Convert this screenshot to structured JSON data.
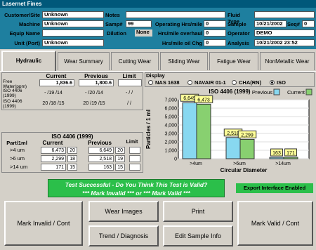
{
  "window": {
    "title": "Lasernet Fines"
  },
  "header": {
    "customer_label": "Customer/Site",
    "customer_value": "Unknown",
    "machine_label": "Machine",
    "machine_value": "Unknown",
    "equip_label": "Equip Name",
    "equip_value": "",
    "unit_label": "Unit (Port)",
    "unit_value": "Unknown",
    "notes_label": "Notes",
    "notes_value": "",
    "samp_label": "Samp#",
    "samp_value": "99",
    "dilution_label": "Dilution",
    "dilution_value": "None",
    "op_hrs_label": "Operating Hrs/mile",
    "op_hrs_value": "0",
    "overhaul_label": "Hrs/mile overhaul",
    "overhaul_value": "0",
    "oilchg_label": "Hrs/mile oil Chg",
    "oilchg_value": "0",
    "fluid_label": "Fluid Type",
    "fluid_value": "",
    "sample_label": "Sample",
    "sample_value": "10/21/2002",
    "seq_label": "Seq#",
    "seq_value": "0",
    "operator_label": "Operator",
    "operator_value": "DEMO",
    "analysis_label": "Analysis",
    "analysis_value": "10/21/2002 23:52"
  },
  "tabs": [
    "Hydraulic",
    "Wear Summary",
    "Cutting Wear",
    "Sliding Wear",
    "Fatigue Wear",
    "NonMetallic Wear"
  ],
  "summary": {
    "col_current": "Current",
    "col_previous": "Previous",
    "col_limit": "Limit",
    "free_water_label": "Free Water(ppm)",
    "free_water_current": "1,836.6",
    "free_water_previous": "1,800.6",
    "iso1999_label": "ISO 4406 (1999)",
    "iso1999_current": "- /19 /14",
    "iso1999_previous": "- /20 /14",
    "iso1999_limit": "- / /",
    "iso4406_label": "ISO 4406 (1999)",
    "iso4406_current": "20 /18 /15",
    "iso4406_previous": "20 /19 /15",
    "iso4406_limit": "/ /"
  },
  "counts": {
    "title": "ISO 4406 (1999)",
    "col_part": "Part/1ml",
    "col_current": "Current",
    "col_previous": "Previous",
    "col_limit": "Limit",
    "rows": [
      {
        "size": ">4 um",
        "current": "6,473",
        "cur_code": "20",
        "previous": "6,649",
        "prev_code": "20"
      },
      {
        "size": ">6 um",
        "current": "2,299",
        "cur_code": "18",
        "previous": "2,518",
        "prev_code": "19"
      },
      {
        "size": ">14 um",
        "current": "171",
        "cur_code": "15",
        "previous": "163",
        "prev_code": "15"
      }
    ]
  },
  "display": {
    "label": "Display",
    "options": [
      "NAS 1638",
      "NAVAIR 01-1",
      "CHA(RN)",
      "ISO"
    ],
    "selected": "ISO"
  },
  "chart_data": {
    "type": "bar",
    "title": "ISO 4406 (1999)",
    "xlabel": "Circular Diameter",
    "ylabel": "Particles / 1 ml",
    "categories": [
      ">4um",
      ">6um",
      ">14um"
    ],
    "series": [
      {
        "name": "Previous",
        "values": [
          6649,
          2518,
          163
        ],
        "color": "#88d8f0"
      },
      {
        "name": "Current",
        "values": [
          6473,
          2299,
          171
        ],
        "color": "#88d070"
      }
    ],
    "data_labels_prev": [
      "6,649",
      "2,518",
      "163"
    ],
    "data_labels_cur": [
      "6,473",
      "2,299",
      "171"
    ],
    "yticks": [
      "7,000",
      "6,000",
      "5,000",
      "4,000",
      "3,000",
      "2,000",
      "1,000",
      "0"
    ],
    "ylim": [
      0,
      7000
    ]
  },
  "status": {
    "line1": "Test Successful  -  Do You Think This Test is Valid?",
    "line2": "*** Mark Invalid ***  or  *** Mark Valid ***",
    "export_label": "Export Interface Enabled"
  },
  "buttons": {
    "invalid": "Mark Invalid / Cont",
    "wear_images": "Wear Images",
    "print": "Print",
    "valid": "Mark Valid / Cont",
    "trend": "Trend / Diagnosis",
    "edit": "Edit Sample Info"
  }
}
